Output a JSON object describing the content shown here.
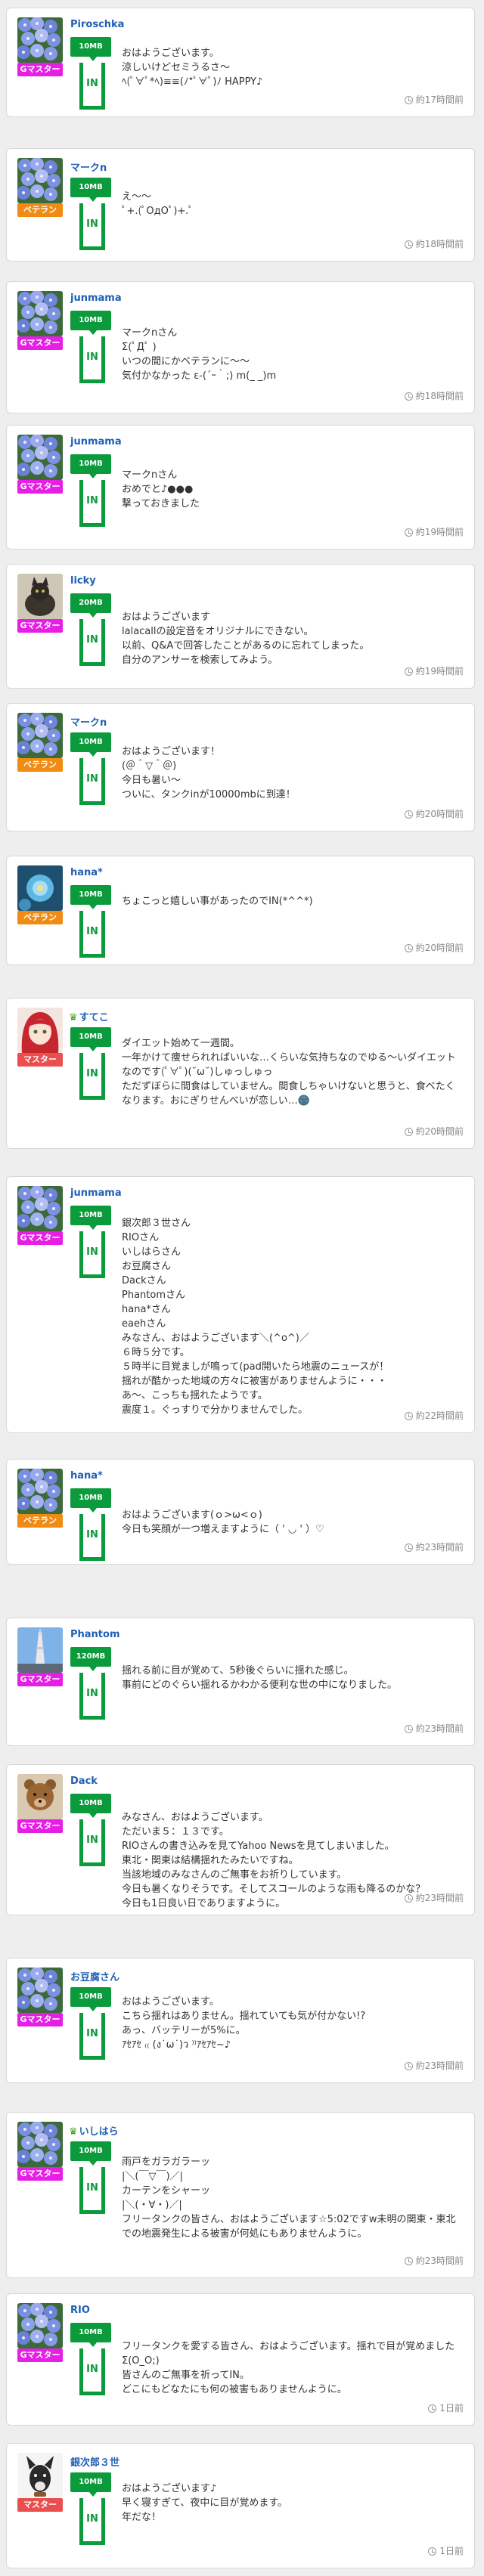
{
  "posts": [
    {
      "user": "Piroschka",
      "lead_mark": "",
      "badge": "Gマスター",
      "badge_color": "#e61ee6",
      "avatar": "hydrangea",
      "mb": "10MB",
      "in_label": "IN",
      "time": "約17時間前",
      "lines": [
        "おはようございます。",
        "涼しいけどセミうるさ～",
        "ﾍ(ﾟ∀ﾟ*ﾍ)≡≡(ﾉ*ﾟ∀ﾟ)ﾉ HAPPY♪"
      ]
    },
    {
      "user": "マークn",
      "lead_mark": "",
      "badge": "ベテラン",
      "badge_color": "#f08c14",
      "avatar": "hydrangea",
      "mb": "10MB",
      "in_label": "IN",
      "time": "約18時間前",
      "lines": [
        "え～～",
        "ﾟ+.(ﾟOдOﾟ)+.ﾟ"
      ]
    },
    {
      "user": "junmama",
      "lead_mark": "",
      "badge": "Gマスター",
      "badge_color": "#e61ee6",
      "avatar": "hydrangea",
      "mb": "10MB",
      "in_label": "IN",
      "time": "約18時間前",
      "lines": [
        "マークnさん",
        "Σ(ﾟДﾟ )",
        "いつの間にかベテランに～～",
        "気付かなかった ε-(´ｰ｀;) m(_ _)m"
      ]
    },
    {
      "user": "junmama",
      "lead_mark": "",
      "badge": "Gマスター",
      "badge_color": "#e61ee6",
      "avatar": "hydrangea",
      "mb": "10MB",
      "in_label": "IN",
      "time": "約19時間前",
      "lines": [
        "マークnさん",
        "おめでと♪●●●",
        "撃っておきました"
      ]
    },
    {
      "user": "licky",
      "lead_mark": "",
      "badge": "Gマスター",
      "badge_color": "#e61ee6",
      "avatar": "cat",
      "mb": "20MB",
      "in_label": "IN",
      "time": "約19時間前",
      "lines": [
        "おはようございます",
        "lalacallの設定音をオリジナルにできない。",
        "以前、Q&Aで回答したことがあるのに忘れてしまった。",
        "自分のアンサーを検索してみよう。"
      ]
    },
    {
      "user": "マークn",
      "lead_mark": "",
      "badge": "ベテラン",
      "badge_color": "#f08c14",
      "avatar": "hydrangea",
      "mb": "10MB",
      "in_label": "IN",
      "time": "約20時間前",
      "lines": [
        "おはようございます！",
        "(＠＾▽＾＠)",
        "今日も暑い～",
        "ついに、タンクinが10000mbに到達！"
      ]
    },
    {
      "user": "hana*",
      "lead_mark": "",
      "badge": "ベテラン",
      "badge_color": "#f08c14",
      "avatar": "flower_blue",
      "mb": "10MB",
      "in_label": "IN",
      "time": "約20時間前",
      "lines": [
        "ちょこっと嬉しい事があったのでIN(*^^*)"
      ]
    },
    {
      "user": "すてこ",
      "lead_mark": "♛",
      "badge": "マスター",
      "badge_color": "#ea4e4e",
      "avatar": "anime",
      "mb": "10MB",
      "in_label": "IN",
      "time": "約20時間前",
      "lines": [
        "ダイエット始めて一週間。",
        "一年かけて痩せられればいいな…くらいな気持ちなのでゆる～いダイエットなのです(ﾟ∀ﾟ)(˘ω˘)しゅっしゅっ",
        "ただずぼらに間食はしていません。間食しちゃいけないと思うと、食べたくなります。おにぎりせんべいが恋しい…🌚"
      ]
    },
    {
      "user": "junmama",
      "lead_mark": "",
      "badge": "Gマスター",
      "badge_color": "#e61ee6",
      "avatar": "hydrangea",
      "mb": "10MB",
      "in_label": "IN",
      "time": "約22時間前",
      "lines": [
        "銀次郎３世さん",
        "RIOさん",
        "いしはらさん",
        "お豆腐さん",
        "Dackさん",
        "Phantomさん",
        "hana*さん",
        "eaehさん",
        "みなさん、おはようございます＼(^o^)／",
        "６時５分です。",
        "５時半に目覚ましが鳴って(pad開いたら地震のニュースが！",
        "揺れが酷かった地域の方々に被害がありませんように・・・",
        "あ～、こっちも揺れたようです。",
        "震度１。ぐっすりで分かりませんでした。"
      ]
    },
    {
      "user": "hana*",
      "lead_mark": "",
      "badge": "ベテラン",
      "badge_color": "#f08c14",
      "avatar": "hydrangea",
      "mb": "10MB",
      "in_label": "IN",
      "time": "約23時間前",
      "lines": [
        "おはようございます(ｏ>ω<ｏ)",
        "今日も笑顔が一つ増えますように（ ' ◡ ' ）♡"
      ]
    },
    {
      "user": "Phantom",
      "lead_mark": "",
      "badge": "Gマスター",
      "badge_color": "#e61ee6",
      "avatar": "tower",
      "mb": "120MB",
      "in_label": "IN",
      "time": "約23時間前",
      "lines": [
        "揺れる前に目が覚めて、5秒後ぐらいに揺れた感じ。",
        "事前にどのぐらい揺れるかわかる便利な世の中になりました。"
      ]
    },
    {
      "user": "Dack",
      "lead_mark": "",
      "badge": "Gマスター",
      "badge_color": "#e61ee6",
      "avatar": "bear",
      "mb": "10MB",
      "in_label": "IN",
      "time": "約23時間前",
      "lines": [
        "みなさん、おはようございます。",
        "ただいま５：１３です。",
        "RIOさんの書き込みを見てYahoo Newsを見てしまいました。",
        "東北・関東は結構揺れたみたいですね。",
        "当該地域のみなさんのご無事をお祈りしています。",
        "今日も暑くなりそうです。そしてスコールのような雨も降るのかな？",
        "今日も1日良い日でありますように。"
      ]
    },
    {
      "user": "お豆腐さん",
      "lead_mark": "",
      "badge": "Gマスター",
      "badge_color": "#e61ee6",
      "avatar": "hydrangea",
      "mb": "10MB",
      "in_label": "IN",
      "time": "約23時間前",
      "lines": [
        "おはようございます。",
        "こちら揺れはありません。揺れていても気が付かない!?",
        "あっ、バッテリーが5%に。",
        "ｱｾｱｾ ₍₍ (ง˙ω˙)ว ⁾⁾ｱｾｱｾ~♪"
      ]
    },
    {
      "user": "いしはら",
      "lead_mark": "♛",
      "badge": "Gマスター",
      "badge_color": "#e61ee6",
      "avatar": "hydrangea",
      "mb": "10MB",
      "in_label": "IN",
      "time": "約23時間前",
      "lines": [
        "雨戸をガラガラーッ",
        "|＼(￣▽￣)／|",
        "カーテンをシャーッ",
        "|＼(・∀・)／|",
        "フリータンクの皆さん、おはようございます☆5:02ですw未明の関東・東北での地震発生による被害が何処にもありませんように。"
      ]
    },
    {
      "user": "RIO",
      "lead_mark": "",
      "badge": "Gマスター",
      "badge_color": "#e61ee6",
      "avatar": "hydrangea",
      "mb": "10MB",
      "in_label": "IN",
      "time": "1日前",
      "lines": [
        "フリータンクを愛する皆さん、おはようございます。揺れで目が覚めました Σ(O_O;)",
        "皆さんのご無事を祈ってIN。",
        "どこにもどなたにも何の被害もありませんように。"
      ]
    },
    {
      "user": "銀次郎３世",
      "lead_mark": "",
      "badge": "マスター",
      "badge_color": "#ea4e4e",
      "avatar": "dog",
      "mb": "10MB",
      "in_label": "IN",
      "time": "1日前",
      "lines": [
        "おはようございます♪",
        "早く寝すぎて、夜中に目が覚めます。",
        "年だな！"
      ]
    }
  ]
}
